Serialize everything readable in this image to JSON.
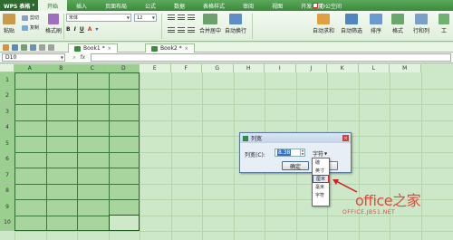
{
  "menubar": {
    "app_name": "WPS 表格",
    "items": [
      "开始",
      "插入",
      "页面布局",
      "公式",
      "数据",
      "表格样式",
      "审阅",
      "视图",
      "开发工具"
    ],
    "office_space": "办公空间"
  },
  "ribbon": {
    "paste": "粘贴",
    "cut": "剪切",
    "copy": "复制",
    "format_painter": "格式刷",
    "font_name": "宋体",
    "font_size": "12",
    "merge_center": "合并居中",
    "wrap_text": "自动换行",
    "auto_sum": "自动求和",
    "auto_filter": "自动筛选",
    "sort": "排序",
    "format": "格式",
    "row_col": "行和列",
    "worksheet": "工"
  },
  "tabs": [
    {
      "label": "Book1 *"
    },
    {
      "label": "Book2 *"
    }
  ],
  "formula_bar": {
    "name_box": "D10",
    "fx_label": "fx"
  },
  "grid": {
    "columns": [
      "A",
      "B",
      "C",
      "D",
      "E",
      "F",
      "G",
      "H",
      "I",
      "J",
      "K",
      "L",
      "M"
    ],
    "rows": [
      "1",
      "2",
      "3",
      "4",
      "5",
      "6",
      "7",
      "8",
      "9",
      "10"
    ]
  },
  "dialog": {
    "title": "列宽",
    "label": "列宽(C):",
    "value": "8.38",
    "unit": "字符",
    "ok": "确定",
    "cancel": "消"
  },
  "dropdown": {
    "items": [
      "磅",
      "英寸",
      "厘米",
      "毫米",
      "字符"
    ],
    "highlighted_index": 2
  },
  "watermark": {
    "brand": "office之家",
    "url": "OFFICE.JB51.NET"
  }
}
